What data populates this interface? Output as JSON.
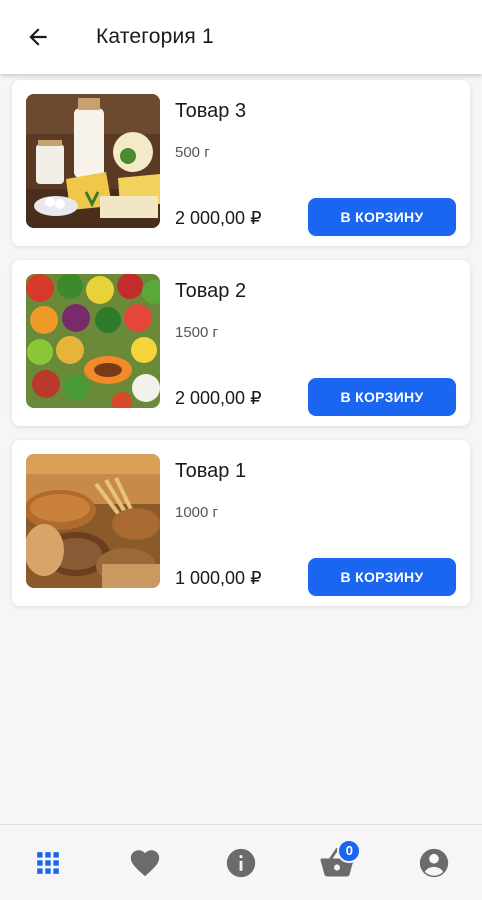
{
  "appbar": {
    "title": "Категория 1"
  },
  "products": [
    {
      "name": "Товар 3",
      "weight": "500 г",
      "price": "2 000,00 ₽",
      "button": "В КОРЗИНУ",
      "image": "dairy-image"
    },
    {
      "name": "Товар 2",
      "weight": "1500 г",
      "price": "2 000,00 ₽",
      "button": "В КОРЗИНУ",
      "image": "vegetables-image"
    },
    {
      "name": "Товар 1",
      "weight": "1000 г",
      "price": "1 000,00 ₽",
      "button": "В КОРЗИНУ",
      "image": "bread-image"
    }
  ],
  "bottom_nav": {
    "items": [
      {
        "icon": "grid-icon",
        "active": true
      },
      {
        "icon": "heart-icon",
        "active": false
      },
      {
        "icon": "info-icon",
        "active": false
      },
      {
        "icon": "basket-icon",
        "active": false
      },
      {
        "icon": "account-icon",
        "active": false
      }
    ],
    "cart_count": "0"
  },
  "colors": {
    "accent": "#1a66f0",
    "icon_inactive": "#6b6b6b",
    "background": "#f6f6f8"
  }
}
